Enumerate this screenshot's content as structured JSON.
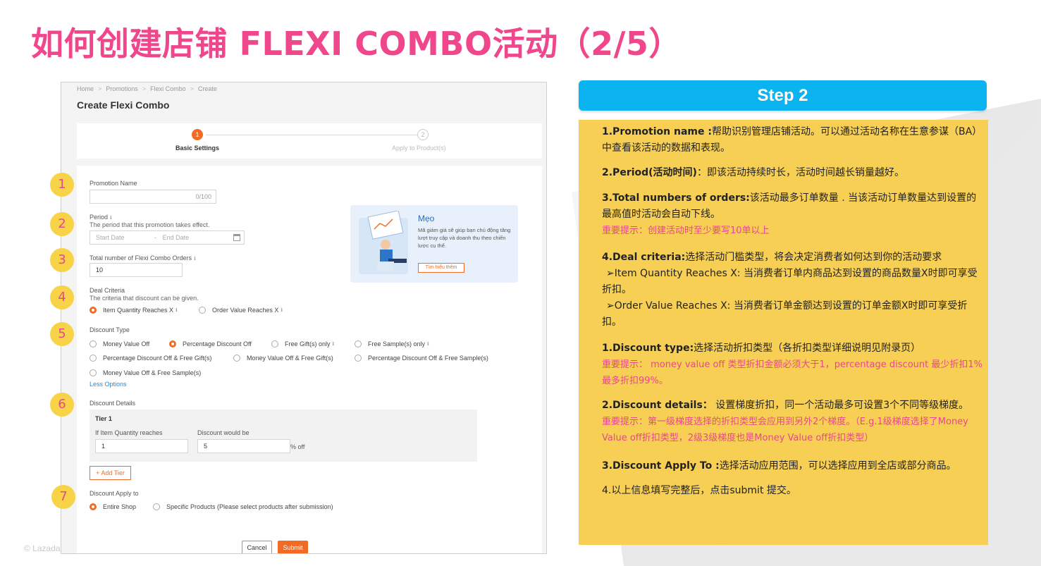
{
  "slide": {
    "title": "如何创建店铺 FLEXI COMBO活动（2/5）",
    "footer": "© Lazada"
  },
  "shot": {
    "breadcrumb": [
      "Home",
      ">",
      "Promotions",
      ">",
      "Flexi Combo",
      ">",
      "Create"
    ],
    "page_title": "Create Flexi Combo",
    "steps": [
      {
        "num": "1",
        "label": "Basic Settings"
      },
      {
        "num": "2",
        "label": "Apply to Product(s)"
      }
    ],
    "promotion_name": {
      "label": "Promotion Name",
      "counter": "0/100"
    },
    "period": {
      "label": "Period",
      "desc": "The period that this promotion takes effect.",
      "start_placeholder": "Start Date",
      "sep": "-",
      "end_placeholder": "End Date"
    },
    "orders": {
      "label": "Total number of Flexi Combo Orders",
      "value": "10"
    },
    "deal": {
      "label": "Deal Criteria",
      "desc": "The criteria that discount can be given.",
      "options": [
        "Item Quantity Reaches X",
        "Order Value Reaches X"
      ]
    },
    "discount_type": {
      "label": "Discount Type",
      "options": [
        "Money Value Off",
        "Percentage Discount Off",
        "Free Gift(s) only",
        "Free Sample(s) only",
        "Percentage Discount Off & Free Gift(s)",
        "Money Value Off & Free Gift(s)",
        "Percentage Discount Off & Free Sample(s)",
        "Money Value Off & Free Sample(s)"
      ],
      "less": "Less Options"
    },
    "details": {
      "label": "Discount Details",
      "tier": "Tier 1",
      "qty_label": "If Item Quantity reaches",
      "qty_value": "1",
      "disc_label": "Discount would be",
      "disc_value": "5",
      "disc_unit": "% off",
      "add_tier": "+ Add Tier"
    },
    "apply": {
      "label": "Discount Apply to",
      "options": [
        "Entire Shop",
        "Specific Products (Please select products after submission)"
      ]
    },
    "buttons": {
      "cancel": "Cancel",
      "submit": "Submit"
    },
    "tip": {
      "title": "Mẹo",
      "text": "Mã giảm giá sẽ giúp bạn chủ động tăng lượt truy cập và doanh thu theo chiến lược cụ thể.",
      "button": "Tìm hiểu thêm"
    }
  },
  "markers": [
    "1",
    "2",
    "3",
    "4",
    "5",
    "6",
    "7"
  ],
  "explain": {
    "step": "Step 2",
    "p1_b": "1.Promotion name :",
    "p1": "帮助识别管理店铺活动。可以通过活动名称在生意参谋（BA）中查看该活动的数据和表现。",
    "p2_b": "2.Period(活动时间)",
    "p2": "：即该活动持续时长，活动时间越长销量越好。",
    "p3_b": "3.Total numbers of orders:",
    "p3": "该活动最多订单数量 . 当该活动订单数量达到设置的最高值时活动会自动下线。",
    "p3_red": "重要提示：创建活动时至少要写10单以上",
    "p4_b": "4.Deal criteria:",
    "p4": "选择活动门槛类型，将会决定消费者如何达到你的活动要求",
    "p4_a": "➢Item Quantity Reaches X: 当消费者订单内商品达到设置的商品数量X时即可享受折扣。",
    "p4_c": "➢Order Value Reaches X: 当消费者订单金额达到设置的订单金额X时即可享受折扣。",
    "p5_b": "1.Discount type:",
    "p5": "选择活动折扣类型（各折扣类型详细说明见附录页）",
    "p5_red": "重要提示： money value off 类型折扣金额必须大于1，percentage discount 最少折扣1%最多折扣99%。",
    "p6_b": "2.Discount details：",
    "p6": " 设置梯度折扣，同一个活动最多可设置3个不同等级梯度。",
    "p6_red": "重要提示：第一级梯度选择的折扣类型会应用到另外2个梯度。（E.g.1级梯度选择了Money Value off折扣类型，2级3级梯度也是Money Value off折扣类型）",
    "p7_b": "3.Discount Apply To :",
    "p7": "选择活动应用范围，可以选择应用到全店或部分商品。",
    "p8": "4.以上信息填写完整后，点击submit 提交。"
  }
}
